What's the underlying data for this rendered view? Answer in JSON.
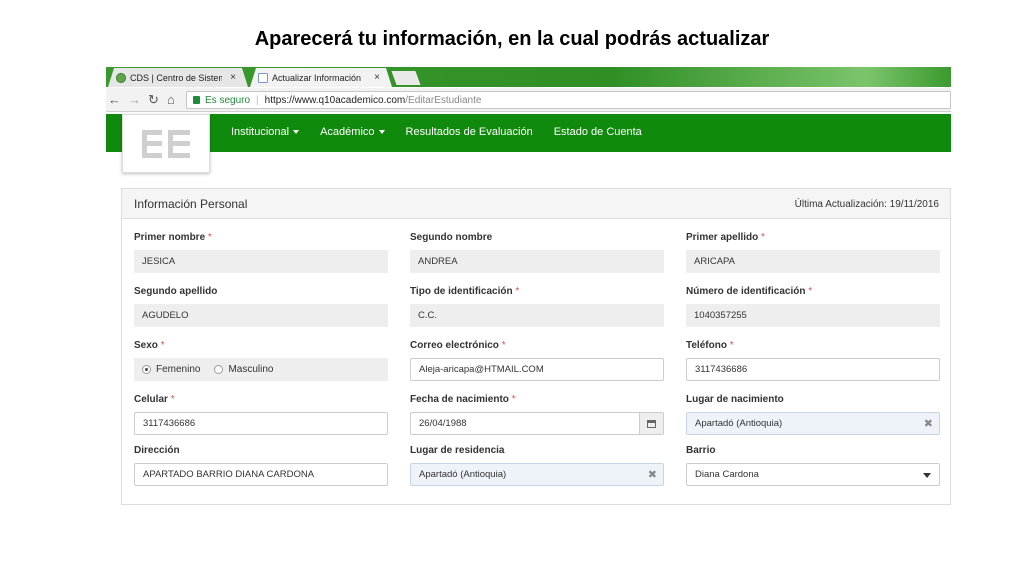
{
  "slide_title": "Aparecerá tu información, en la cual podrás actualizar",
  "browser": {
    "tabs": [
      {
        "label": "CDS | Centro de Sistema",
        "close": "×"
      },
      {
        "label": "Actualizar Información",
        "close": "×"
      }
    ],
    "secure_label": "Es seguro",
    "url_host": "https://www.q10academico.com",
    "url_path": "/EditarEstudiante"
  },
  "nav": {
    "menu": [
      {
        "label": "Institucional",
        "dropdown": true
      },
      {
        "label": "Académico",
        "dropdown": true
      },
      {
        "label": "Resultados de Evaluación",
        "dropdown": false
      },
      {
        "label": "Estado de Cuenta",
        "dropdown": false
      }
    ]
  },
  "panel": {
    "title": "Información Personal",
    "last_update": "Última Actualización: 19/11/2016"
  },
  "fields": {
    "primer_nombre": {
      "label": "Primer nombre",
      "required": "*",
      "value": "JESICA"
    },
    "segundo_nombre": {
      "label": "Segundo nombre",
      "value": "ANDREA"
    },
    "primer_apellido": {
      "label": "Primer apellido",
      "required": "*",
      "value": "ARICAPA"
    },
    "segundo_apellido": {
      "label": "Segundo apellido",
      "value": "AGUDELO"
    },
    "tipo_identificacion": {
      "label": "Tipo de identificación",
      "required": "*",
      "value": "C.C."
    },
    "numero_identificacion": {
      "label": "Número de identificación",
      "required": "*",
      "value": "1040357255"
    },
    "sexo": {
      "label": "Sexo",
      "required": "*",
      "options": [
        "Femenino",
        "Masculino"
      ],
      "selected": "Femenino"
    },
    "correo": {
      "label": "Correo electrónico",
      "required": "*",
      "value": "Aleja-aricapa@HTMAIL.COM"
    },
    "telefono": {
      "label": "Teléfono",
      "required": "*",
      "value": "3117436686"
    },
    "celular": {
      "label": "Celular",
      "required": "*",
      "value": "3117436686"
    },
    "fecha_nacimiento": {
      "label": "Fecha de nacimiento",
      "required": "*",
      "value": "26/04/1988"
    },
    "lugar_nacimiento": {
      "label": "Lugar de nacimiento",
      "value": "Apartadó (Antioquia)"
    },
    "direccion": {
      "label": "Dirección",
      "value": "APARTADO BARRIO DIANA CARDONA"
    },
    "lugar_residencia": {
      "label": "Lugar de residencia",
      "value": "Apartadó (Antioquia)"
    },
    "barrio": {
      "label": "Barrio",
      "value": "Diana Cardona"
    }
  },
  "colors": {
    "nav_green": "#108a0c",
    "required_red": "#d9534f"
  }
}
